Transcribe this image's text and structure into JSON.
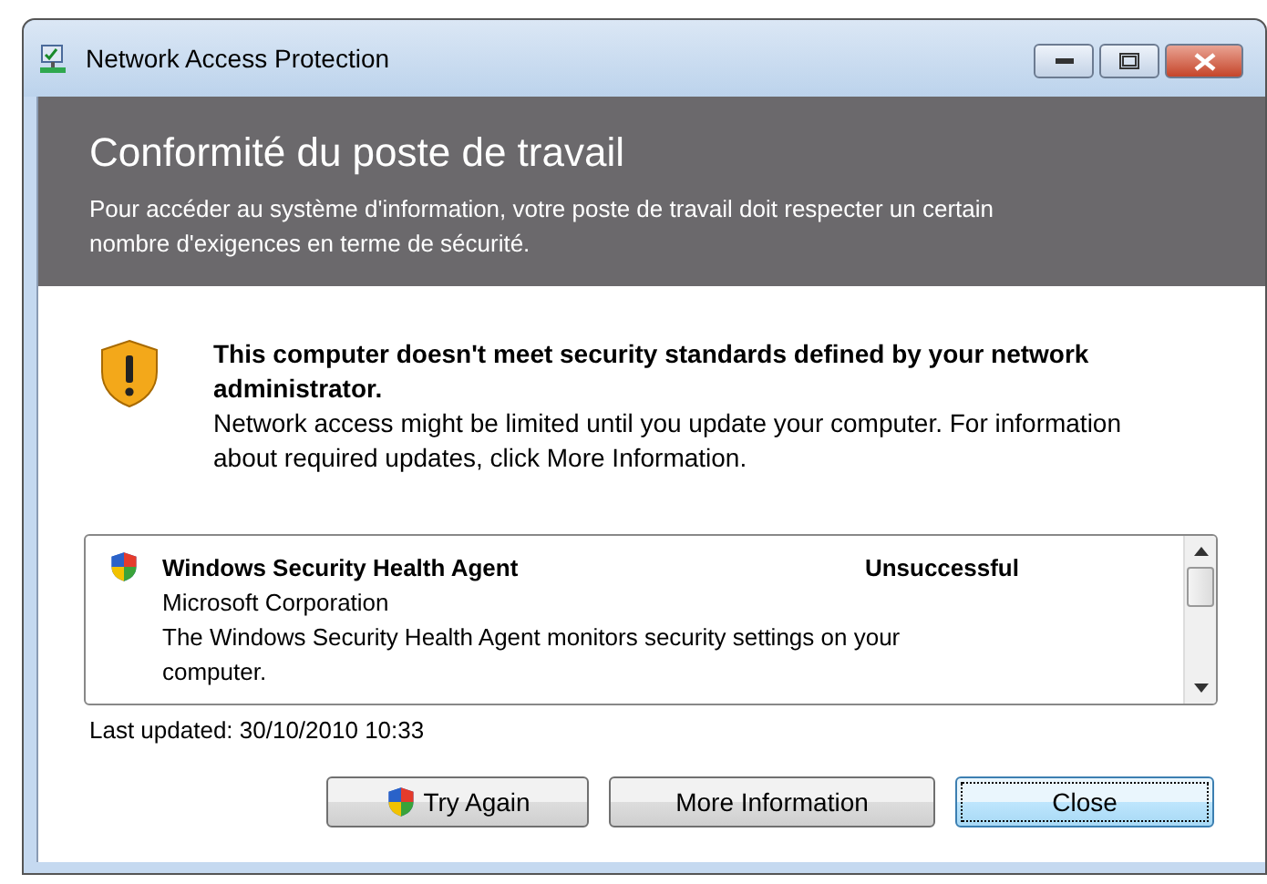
{
  "window": {
    "title": "Network Access Protection"
  },
  "header": {
    "title": "Conformité du poste de travail",
    "description": "Pour accéder au système d'information, votre poste de travail doit respecter un certain nombre d'exigences en terme de sécurité."
  },
  "warning": {
    "title": "This computer doesn't meet security standards defined by your network administrator.",
    "text": "Network access might be limited until you update your computer. For information about required updates, click More Information."
  },
  "agents": [
    {
      "name": "Windows Security Health Agent",
      "status": "Unsuccessful",
      "publisher": "Microsoft Corporation",
      "description": "The Windows Security Health Agent monitors security settings on your computer."
    }
  ],
  "last_updated": "Last updated: 30/10/2010 10:33",
  "buttons": [
    {
      "label": "Try Again",
      "shield": true,
      "focused": false
    },
    {
      "label": "More Information",
      "shield": false,
      "focused": false
    },
    {
      "label": "Close",
      "shield": false,
      "focused": true
    }
  ]
}
